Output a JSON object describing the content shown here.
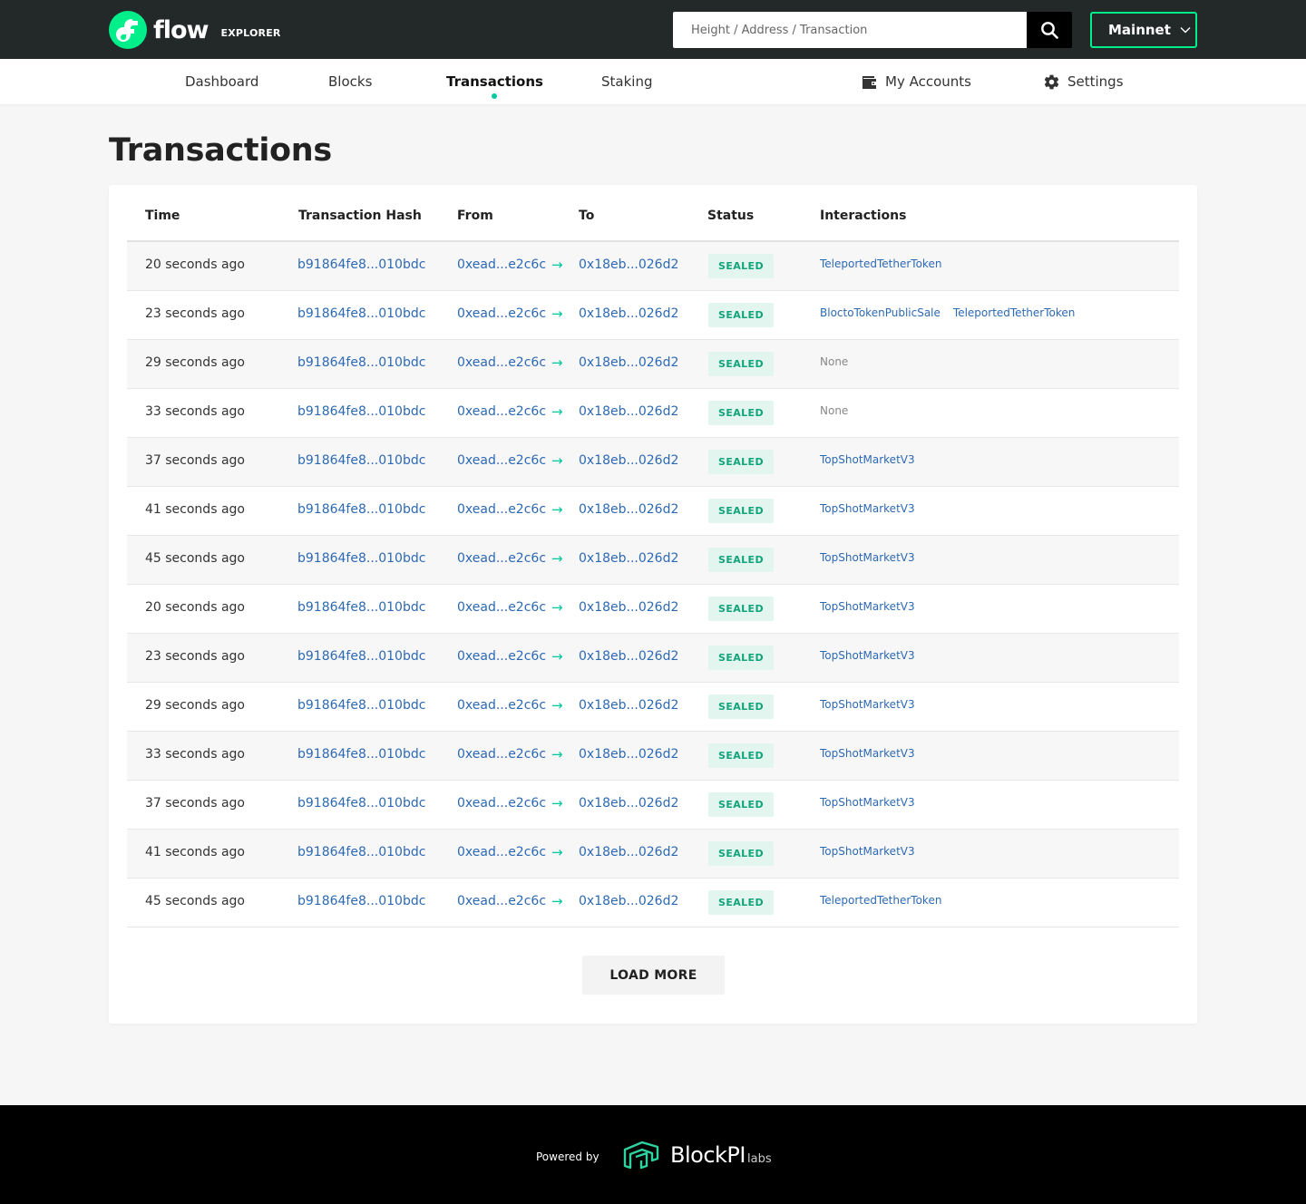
{
  "header": {
    "logo_word": "flow",
    "logo_sub": "EXPLORER",
    "search_placeholder": "Height / Address / Transaction",
    "network_label": "Mainnet",
    "accent_color": "#00ef8b"
  },
  "nav": {
    "items": [
      {
        "label": "Dashboard",
        "active": false
      },
      {
        "label": "Blocks",
        "active": false
      },
      {
        "label": "Transactions",
        "active": true
      },
      {
        "label": "Staking",
        "active": false
      }
    ],
    "right": [
      {
        "label": "My Accounts",
        "icon": "wallet-icon"
      },
      {
        "label": "Settings",
        "icon": "gear-icon"
      }
    ]
  },
  "page": {
    "title": "Transactions"
  },
  "table": {
    "columns": [
      "Time",
      "Transaction Hash",
      "From",
      "To",
      "Status",
      "Interactions"
    ],
    "arrow": "→",
    "rows": [
      {
        "time": "20 seconds ago",
        "hash": "b91864fe8...010bdc",
        "from": "0xead...e2c6c",
        "to": "0x18eb...026d2",
        "status": "SEALED",
        "interactions": [
          "TeleportedTetherToken"
        ]
      },
      {
        "time": "23 seconds ago",
        "hash": "b91864fe8...010bdc",
        "from": "0xead...e2c6c",
        "to": "0x18eb...026d2",
        "status": "SEALED",
        "interactions": [
          "BloctoTokenPublicSale",
          "TeleportedTetherToken"
        ]
      },
      {
        "time": "29 seconds ago",
        "hash": "b91864fe8...010bdc",
        "from": "0xead...e2c6c",
        "to": "0x18eb...026d2",
        "status": "SEALED",
        "interactions": []
      },
      {
        "time": "33 seconds ago",
        "hash": "b91864fe8...010bdc",
        "from": "0xead...e2c6c",
        "to": "0x18eb...026d2",
        "status": "SEALED",
        "interactions": []
      },
      {
        "time": "37 seconds ago",
        "hash": "b91864fe8...010bdc",
        "from": "0xead...e2c6c",
        "to": "0x18eb...026d2",
        "status": "SEALED",
        "interactions": [
          "TopShotMarketV3"
        ]
      },
      {
        "time": "41 seconds ago",
        "hash": "b91864fe8...010bdc",
        "from": "0xead...e2c6c",
        "to": "0x18eb...026d2",
        "status": "SEALED",
        "interactions": [
          "TopShotMarketV3"
        ]
      },
      {
        "time": "45 seconds ago",
        "hash": "b91864fe8...010bdc",
        "from": "0xead...e2c6c",
        "to": "0x18eb...026d2",
        "status": "SEALED",
        "interactions": [
          "TopShotMarketV3"
        ]
      },
      {
        "time": "20 seconds ago",
        "hash": "b91864fe8...010bdc",
        "from": "0xead...e2c6c",
        "to": "0x18eb...026d2",
        "status": "SEALED",
        "interactions": [
          "TopShotMarketV3"
        ]
      },
      {
        "time": "23 seconds ago",
        "hash": "b91864fe8...010bdc",
        "from": "0xead...e2c6c",
        "to": "0x18eb...026d2",
        "status": "SEALED",
        "interactions": [
          "TopShotMarketV3"
        ]
      },
      {
        "time": "29 seconds ago",
        "hash": "b91864fe8...010bdc",
        "from": "0xead...e2c6c",
        "to": "0x18eb...026d2",
        "status": "SEALED",
        "interactions": [
          "TopShotMarketV3"
        ]
      },
      {
        "time": "33 seconds ago",
        "hash": "b91864fe8...010bdc",
        "from": "0xead...e2c6c",
        "to": "0x18eb...026d2",
        "status": "SEALED",
        "interactions": [
          "TopShotMarketV3"
        ]
      },
      {
        "time": "37 seconds ago",
        "hash": "b91864fe8...010bdc",
        "from": "0xead...e2c6c",
        "to": "0x18eb...026d2",
        "status": "SEALED",
        "interactions": [
          "TopShotMarketV3"
        ]
      },
      {
        "time": "41 seconds ago",
        "hash": "b91864fe8...010bdc",
        "from": "0xead...e2c6c",
        "to": "0x18eb...026d2",
        "status": "SEALED",
        "interactions": [
          "TopShotMarketV3"
        ]
      },
      {
        "time": "45 seconds ago",
        "hash": "b91864fe8...010bdc",
        "from": "0xead...e2c6c",
        "to": "0x18eb...026d2",
        "status": "SEALED",
        "interactions": [
          "TeleportedTetherToken"
        ]
      }
    ],
    "none_label": "None",
    "load_more_label": "LOAD MORE"
  },
  "footer": {
    "powered_by": "Powered by",
    "brand": "BlockPI",
    "brand_suffix": "labs"
  }
}
